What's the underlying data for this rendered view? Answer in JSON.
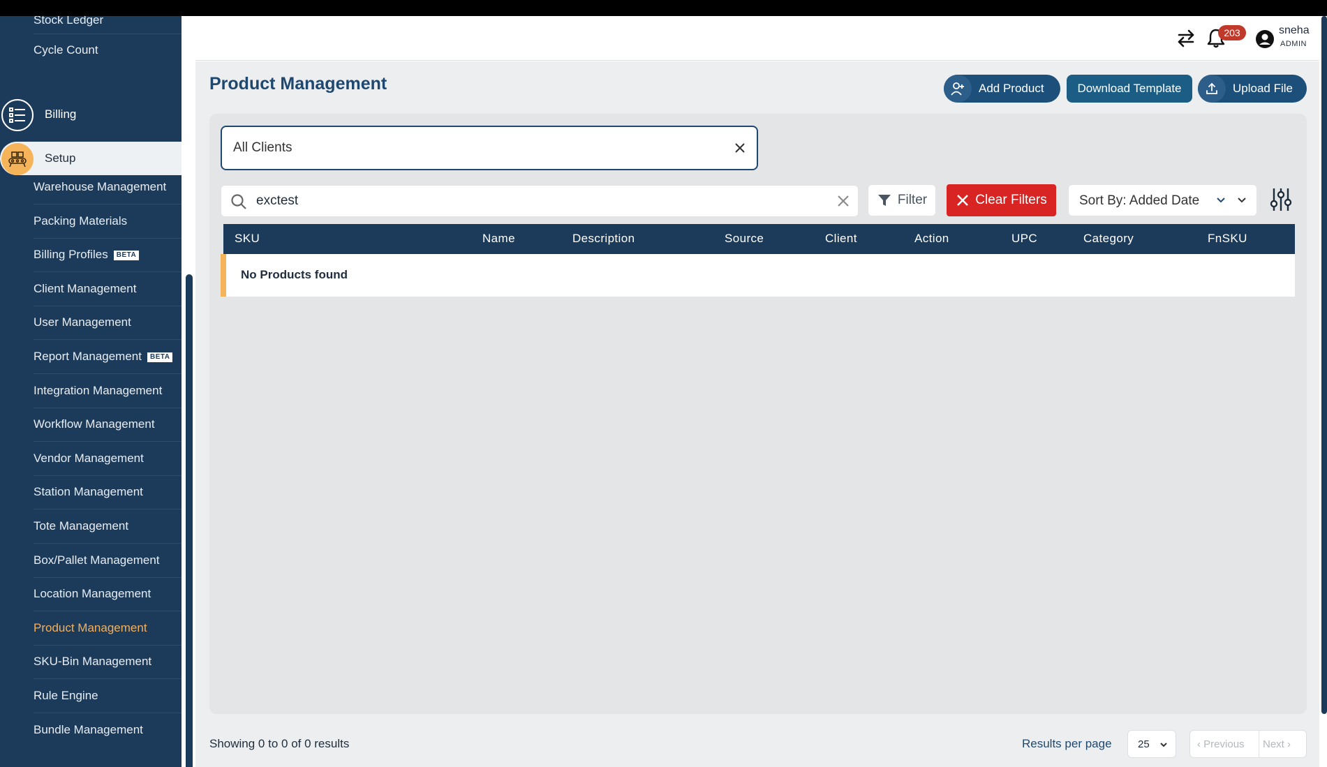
{
  "sidebar": {
    "top_items": [
      "Stock Ledger",
      "Cycle Count"
    ],
    "sections": {
      "billing": {
        "label": "Billing",
        "icon": "list-icon"
      },
      "setup": {
        "label": "Setup",
        "icon": "conveyor-icon"
      }
    },
    "setup_items": [
      {
        "label": "Warehouse Management"
      },
      {
        "label": "Packing Materials"
      },
      {
        "label": "Billing Profiles",
        "badge": "BETA"
      },
      {
        "label": "Client Management"
      },
      {
        "label": "User Management"
      },
      {
        "label": "Report Management",
        "badge": "BETA"
      },
      {
        "label": "Integration Management"
      },
      {
        "label": "Workflow Management"
      },
      {
        "label": "Vendor Management"
      },
      {
        "label": "Station Management"
      },
      {
        "label": "Tote Management"
      },
      {
        "label": "Box/Pallet Management"
      },
      {
        "label": "Location Management"
      },
      {
        "label": "Product Management",
        "active": true
      },
      {
        "label": "SKU-Bin Management"
      },
      {
        "label": "Rule Engine"
      },
      {
        "label": "Bundle Management"
      }
    ],
    "active_color": "#f4b05a"
  },
  "header": {
    "notification_count": "203",
    "user_name": "sneha",
    "user_role": "ADMIN"
  },
  "page": {
    "title": "Product Management",
    "buttons": {
      "add_product": "Add Product",
      "download_template": "Download Template",
      "upload_file": "Upload File"
    }
  },
  "filters": {
    "client_value": "All Clients",
    "search_value": "exctest",
    "filter_label": "Filter",
    "clear_filters_label": "Clear Filters",
    "sort_value": "Sort By: Added Date"
  },
  "table": {
    "columns": [
      "SKU",
      "Name",
      "Description",
      "Source",
      "Client",
      "Action",
      "UPC",
      "Category",
      "FnSKU"
    ],
    "empty_message": "No Products found"
  },
  "footer": {
    "showing": "Showing 0 to 0 of 0 results",
    "results_per_page_label": "Results per page",
    "results_per_page_value": "25",
    "previous": "Previous",
    "next": "Next"
  },
  "colors": {
    "navy": "#1c3b5a",
    "accent_orange": "#f6b45a",
    "clear_red": "#d92424",
    "badge_red": "#c0392b"
  }
}
